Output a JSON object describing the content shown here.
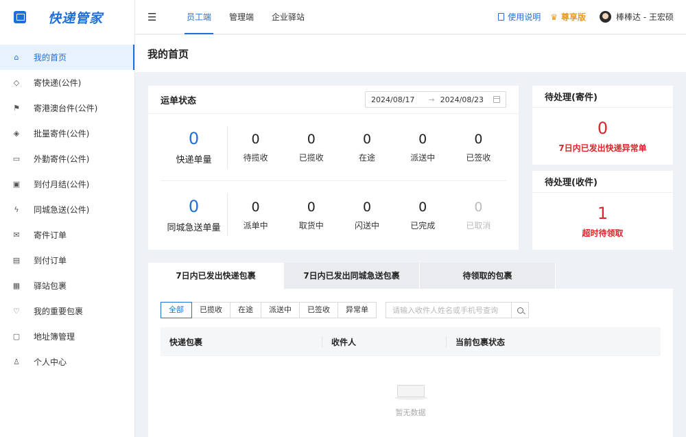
{
  "app": {
    "logo_text": "快递管家"
  },
  "sidebar": {
    "items": [
      {
        "label": "我的首页",
        "icon": "home-icon",
        "glyph": "⌂",
        "active": true
      },
      {
        "label": "寄快递(公件)",
        "icon": "tag-icon",
        "glyph": "◇",
        "active": false
      },
      {
        "label": "寄港澳台件(公件)",
        "icon": "flag-icon",
        "glyph": "⚑",
        "active": false
      },
      {
        "label": "批量寄件(公件)",
        "icon": "tags-icon",
        "glyph": "◈",
        "active": false
      },
      {
        "label": "外勤寄件(公件)",
        "icon": "car-icon",
        "glyph": "▭",
        "active": false
      },
      {
        "label": "到付月结(公件)",
        "icon": "calendar-icon",
        "glyph": "▣",
        "active": false
      },
      {
        "label": "同城急送(公件)",
        "icon": "lightning-icon",
        "glyph": "ϟ",
        "active": false
      },
      {
        "label": "寄件订单",
        "icon": "mail-icon",
        "glyph": "✉",
        "active": false
      },
      {
        "label": "到付订单",
        "icon": "document-icon",
        "glyph": "▤",
        "active": false
      },
      {
        "label": "驿站包裹",
        "icon": "storefront-icon",
        "glyph": "▦",
        "active": false
      },
      {
        "label": "我的重要包裹",
        "icon": "heart-icon",
        "glyph": "♡",
        "active": false
      },
      {
        "label": "地址簿管理",
        "icon": "address-card-icon",
        "glyph": "▢",
        "active": false
      },
      {
        "label": "个人中心",
        "icon": "user-icon",
        "glyph": "♙",
        "active": false
      }
    ]
  },
  "topbar": {
    "tabs": [
      {
        "label": "员工端",
        "active": true
      },
      {
        "label": "管理端",
        "active": false
      },
      {
        "label": "企业驿站",
        "active": false
      }
    ],
    "help_label": "使用说明",
    "vip_label": "尊享版",
    "user_name": "棒棒达 - 王宏硕"
  },
  "page": {
    "title": "我的首页"
  },
  "waybill_status": {
    "title": "运单状态",
    "date_start": "2024/08/17",
    "date_end": "2024/08/23",
    "express": {
      "main": {
        "value": "0",
        "label": "快递单量"
      },
      "items": [
        {
          "value": "0",
          "label": "待揽收",
          "disabled": false
        },
        {
          "value": "0",
          "label": "已揽收",
          "disabled": false
        },
        {
          "value": "0",
          "label": "在途",
          "disabled": false
        },
        {
          "value": "0",
          "label": "派送中",
          "disabled": false
        },
        {
          "value": "0",
          "label": "已签收",
          "disabled": false
        }
      ]
    },
    "city": {
      "main": {
        "value": "0",
        "label": "同城急送单量"
      },
      "items": [
        {
          "value": "0",
          "label": "派单中",
          "disabled": false
        },
        {
          "value": "0",
          "label": "取货中",
          "disabled": false
        },
        {
          "value": "0",
          "label": "闪送中",
          "disabled": false
        },
        {
          "value": "0",
          "label": "已完成",
          "disabled": false
        },
        {
          "value": "0",
          "label": "已取消",
          "disabled": true
        }
      ]
    }
  },
  "pending_send": {
    "title": "待处理(寄件)",
    "value": "0",
    "label": "7日内已发出快递异常单"
  },
  "pending_receive": {
    "title": "待处理(收件)",
    "value": "1",
    "label": "超时待领取"
  },
  "packages": {
    "tabs": [
      {
        "label": "7日内已发出快递包裹",
        "active": true
      },
      {
        "label": "7日内已发出同城急送包裹",
        "active": false
      },
      {
        "label": "待领取的包裹",
        "active": false
      }
    ],
    "filters": [
      {
        "label": "全部",
        "active": true
      },
      {
        "label": "已揽收",
        "active": false
      },
      {
        "label": "在途",
        "active": false
      },
      {
        "label": "派送中",
        "active": false
      },
      {
        "label": "已签收",
        "active": false
      },
      {
        "label": "异常单",
        "active": false
      }
    ],
    "search_placeholder": "请输入收件人姓名或手机号查询",
    "columns": [
      "快递包裹",
      "收件人",
      "当前包裹状态"
    ],
    "empty_text": "暂无数据"
  },
  "colors": {
    "primary": "#1e6fd9",
    "danger": "#d9262b",
    "vip": "#e89a1c"
  }
}
